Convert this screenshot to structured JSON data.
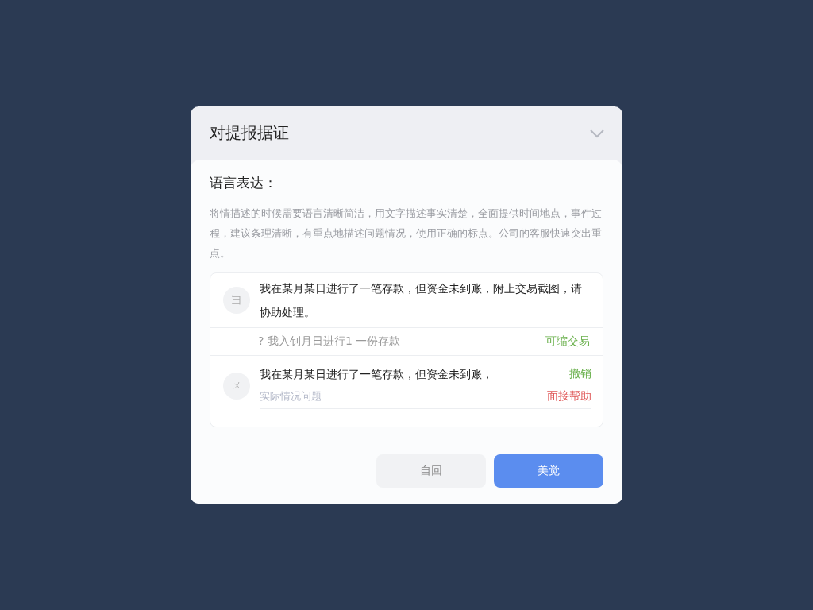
{
  "dialog": {
    "title": "对提报据证",
    "expanded": true
  },
  "section": {
    "label": "语言表达：",
    "description": "将情描述的时候需要语言清晰简洁，用文字描述事实清楚，全面提供时间地点，事件过程，建议条理清晰，有重点地描述问题情况，使用正确的标点。公司的客服快速突出重点。"
  },
  "messages": [
    {
      "kind": "message",
      "icon": "彐",
      "text": "我在某月某日进行了一笔存款，但资金未到账，附上交易截图，请协助处理。"
    },
    {
      "kind": "hint",
      "text": "? 我入钊月日进行1 一份存款",
      "actions": [
        {
          "label": "可缩交易",
          "color": "#6ab04c"
        }
      ]
    },
    {
      "kind": "detail",
      "icon": "ㄨ",
      "text": "我在某月某日进行了一笔存款，但资金未到账，",
      "subtext": "实际情况问题",
      "actions": [
        {
          "label": "撤销",
          "color": "#6ab04c"
        },
        {
          "label": "面接帮助",
          "color": "#e05a5a"
        }
      ]
    }
  ],
  "buttons": [
    {
      "label": "自回",
      "kind": "secondary"
    },
    {
      "label": "美觉",
      "kind": "primary"
    }
  ]
}
